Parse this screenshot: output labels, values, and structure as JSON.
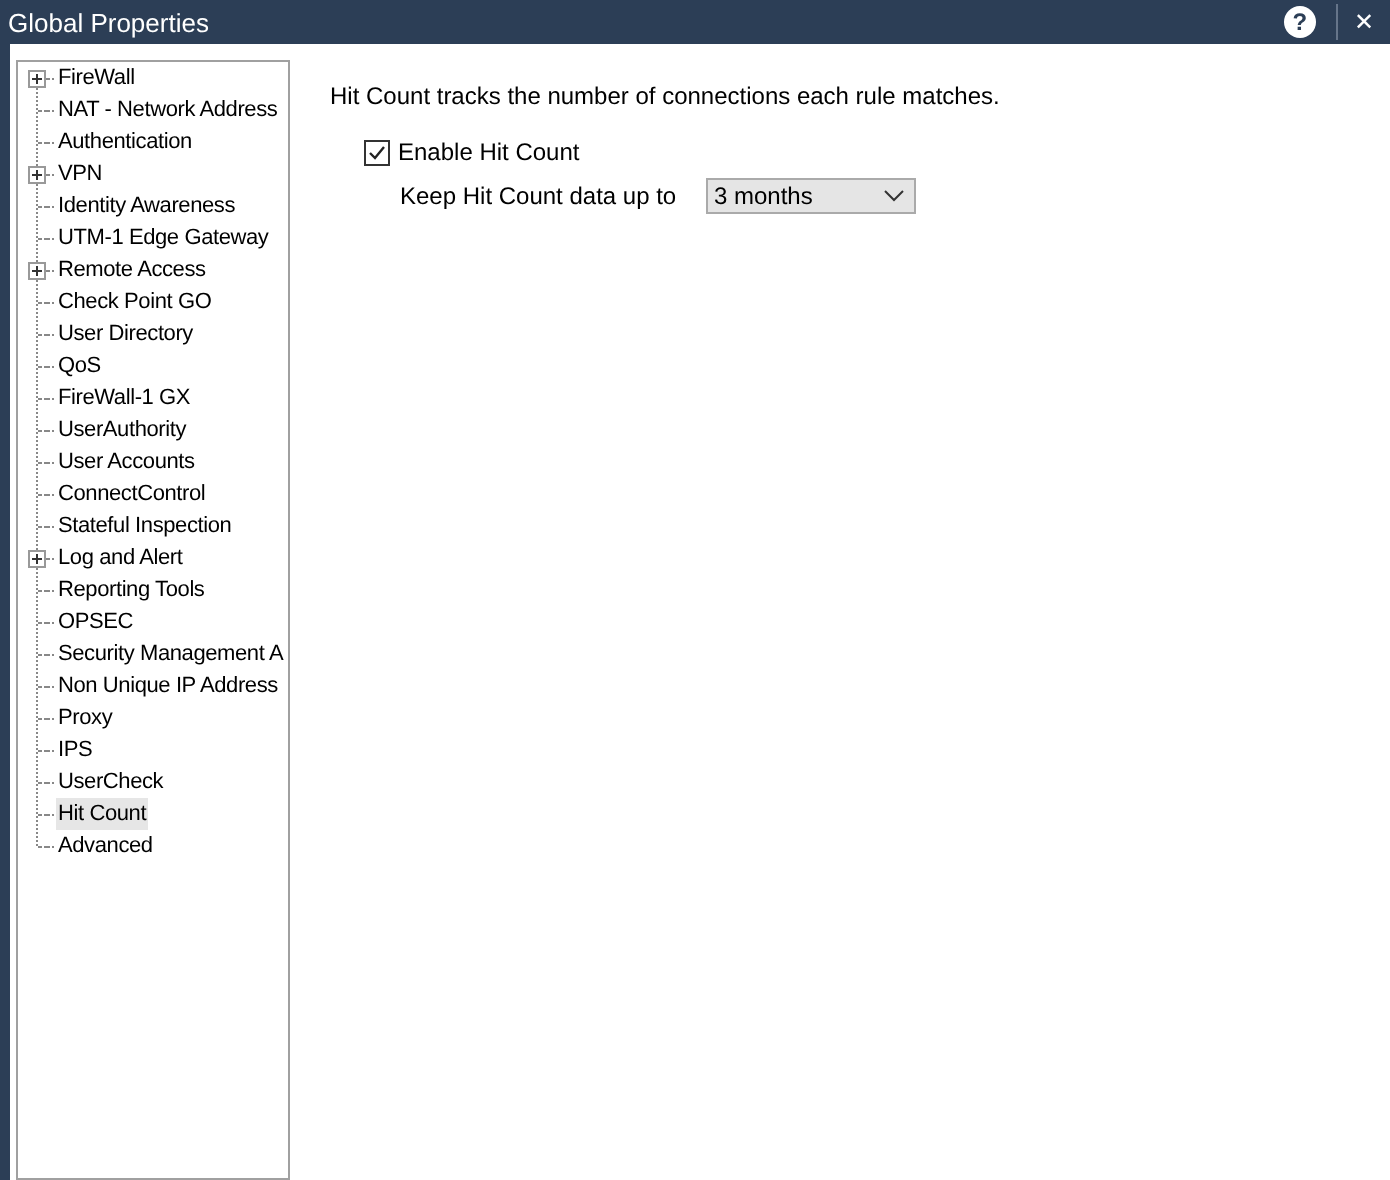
{
  "window": {
    "title": "Global Properties",
    "help": "?",
    "close": "✕"
  },
  "tree": [
    {
      "label": "FireWall",
      "expandable": true,
      "selected": false
    },
    {
      "label": "NAT - Network Address",
      "expandable": false,
      "selected": false
    },
    {
      "label": "Authentication",
      "expandable": false,
      "selected": false
    },
    {
      "label": "VPN",
      "expandable": true,
      "selected": false
    },
    {
      "label": "Identity Awareness",
      "expandable": false,
      "selected": false
    },
    {
      "label": "UTM-1 Edge Gateway",
      "expandable": false,
      "selected": false
    },
    {
      "label": "Remote Access",
      "expandable": true,
      "selected": false
    },
    {
      "label": "Check Point GO",
      "expandable": false,
      "selected": false
    },
    {
      "label": "User Directory",
      "expandable": false,
      "selected": false
    },
    {
      "label": "QoS",
      "expandable": false,
      "selected": false
    },
    {
      "label": "FireWall-1 GX",
      "expandable": false,
      "selected": false
    },
    {
      "label": "UserAuthority",
      "expandable": false,
      "selected": false
    },
    {
      "label": "User Accounts",
      "expandable": false,
      "selected": false
    },
    {
      "label": "ConnectControl",
      "expandable": false,
      "selected": false
    },
    {
      "label": "Stateful Inspection",
      "expandable": false,
      "selected": false
    },
    {
      "label": "Log and Alert",
      "expandable": true,
      "selected": false
    },
    {
      "label": "Reporting Tools",
      "expandable": false,
      "selected": false
    },
    {
      "label": "OPSEC",
      "expandable": false,
      "selected": false
    },
    {
      "label": "Security Management A",
      "expandable": false,
      "selected": false
    },
    {
      "label": "Non Unique IP Address",
      "expandable": false,
      "selected": false
    },
    {
      "label": "Proxy",
      "expandable": false,
      "selected": false
    },
    {
      "label": "IPS",
      "expandable": false,
      "selected": false
    },
    {
      "label": "UserCheck",
      "expandable": false,
      "selected": false
    },
    {
      "label": "Hit Count",
      "expandable": false,
      "selected": true
    },
    {
      "label": "Advanced",
      "expandable": false,
      "selected": false
    }
  ],
  "panel": {
    "description": "Hit Count tracks the number of connections each rule matches.",
    "enable": {
      "label": "Enable Hit Count",
      "checked": true
    },
    "keep": {
      "label": "Keep Hit Count data up to",
      "value": "3 months"
    }
  }
}
